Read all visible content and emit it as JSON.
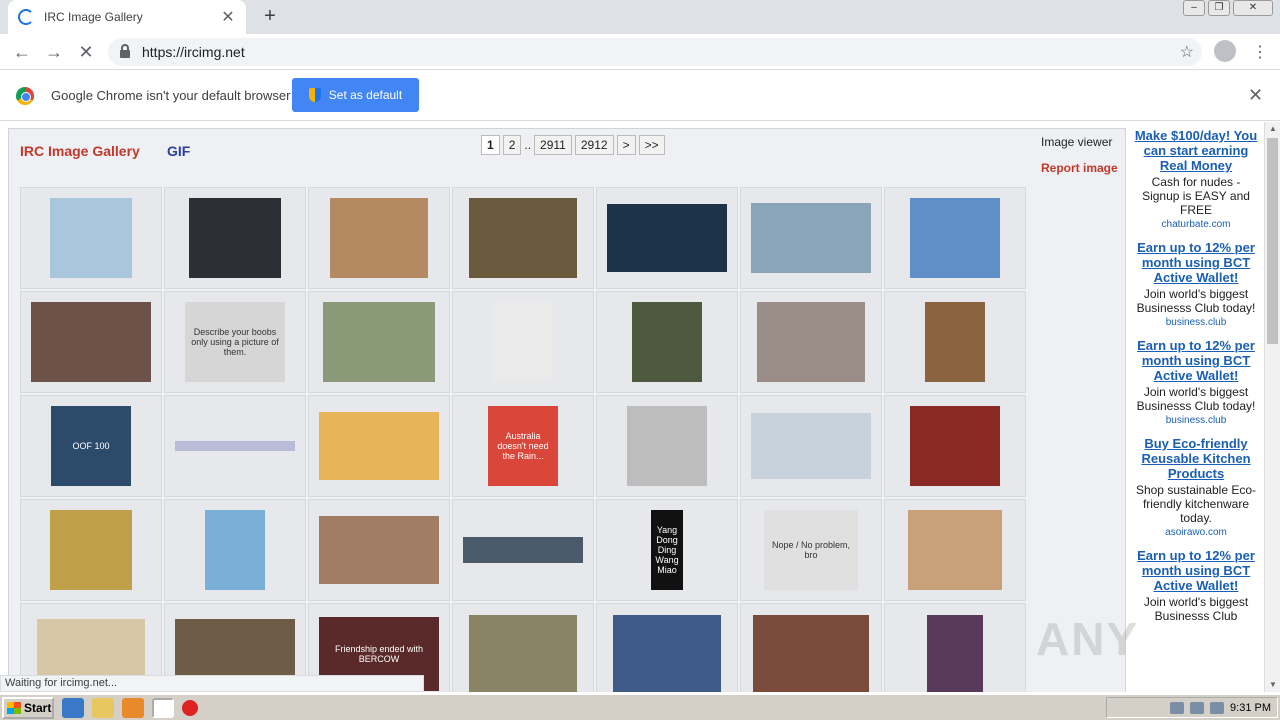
{
  "browser": {
    "tab_title": "IRC Image Gallery",
    "new_tab": "+",
    "tab_close": "✕",
    "url": "https://ircimg.net",
    "infobar_text": "Google Chrome isn't your default browser",
    "set_default_label": "Set as default",
    "infobar_close": "✕",
    "status_text": "Waiting for ircimg.net..."
  },
  "page": {
    "brand": "IRC Image Gallery",
    "gif_link": "GIF",
    "pagination": [
      "1",
      "2",
      "..",
      "2911",
      "2912",
      ">",
      ">>"
    ],
    "active_page": "1",
    "viewer_label": "Image viewer",
    "report_label": "Report image"
  },
  "thumbnails": [
    {
      "name": "cat-meme",
      "color": "#a9c6dc",
      "w": 82,
      "h": 80,
      "caption": ""
    },
    {
      "name": "dark-text-screenshot",
      "color": "#2c3036",
      "w": 92,
      "h": 80,
      "caption": ""
    },
    {
      "name": "cake-meme",
      "color": "#b48a62",
      "w": 98,
      "h": 80,
      "caption": ""
    },
    {
      "name": "breakfast-plate",
      "color": "#6b5a3e",
      "w": 108,
      "h": 80,
      "caption": ""
    },
    {
      "name": "vision-car",
      "color": "#1d3347",
      "w": 120,
      "h": 68,
      "caption": ""
    },
    {
      "name": "rv-camper",
      "color": "#8aa4b8",
      "w": 120,
      "h": 70,
      "caption": ""
    },
    {
      "name": "blastoise",
      "color": "#5f8fc6",
      "w": 90,
      "h": 80,
      "caption": ""
    },
    {
      "name": "woman-eating",
      "color": "#6d5249",
      "w": 120,
      "h": 80,
      "caption": ""
    },
    {
      "name": "describe-text",
      "color": "#d6d6d6",
      "w": 100,
      "h": 80,
      "caption": "Describe your boobs only using a picture of them."
    },
    {
      "name": "game-meme",
      "color": "#8a9a78",
      "w": 112,
      "h": 80,
      "caption": ""
    },
    {
      "name": "chart-list",
      "color": "#eaeaea",
      "w": 60,
      "h": 80,
      "caption": ""
    },
    {
      "name": "armored-figure",
      "color": "#4d5a40",
      "w": 70,
      "h": 80,
      "caption": ""
    },
    {
      "name": "hotel-bed",
      "color": "#9a8c86",
      "w": 108,
      "h": 80,
      "caption": ""
    },
    {
      "name": "kitchen-room",
      "color": "#8a6440",
      "w": 60,
      "h": 80,
      "caption": ""
    },
    {
      "name": "oof-100",
      "color": "#2c4a6a",
      "w": 80,
      "h": 80,
      "caption": "OOF 100"
    },
    {
      "name": "thin-banner",
      "color": "#b8bcd8",
      "w": 120,
      "h": 10,
      "caption": ""
    },
    {
      "name": "emoji-hand",
      "color": "#e8b45a",
      "w": 120,
      "h": 68,
      "caption": ""
    },
    {
      "name": "red-text-post",
      "color": "#d9463a",
      "w": 70,
      "h": 80,
      "caption": "Australia doesn't need the Rain..."
    },
    {
      "name": "cartoon-drawing",
      "color": "#bdbdbd",
      "w": 80,
      "h": 80,
      "caption": ""
    },
    {
      "name": "map-graph",
      "color": "#c8d2dc",
      "w": 120,
      "h": 66,
      "caption": ""
    },
    {
      "name": "deadpool",
      "color": "#8a2a24",
      "w": 90,
      "h": 80,
      "caption": ""
    },
    {
      "name": "comic-spray",
      "color": "#c0a04a",
      "w": 82,
      "h": 80,
      "caption": ""
    },
    {
      "name": "coast-map",
      "color": "#7ab0d8",
      "w": 60,
      "h": 80,
      "caption": ""
    },
    {
      "name": "desert-sunset",
      "color": "#a07e66",
      "w": 120,
      "h": 68,
      "caption": ""
    },
    {
      "name": "horizon-strip",
      "color": "#4a5a6a",
      "w": 120,
      "h": 26,
      "caption": ""
    },
    {
      "name": "name-list",
      "color": "#111111",
      "w": 32,
      "h": 80,
      "caption": "Yang Dong Ding Wang Miao"
    },
    {
      "name": "trollface",
      "color": "#e0e0e0",
      "w": 94,
      "h": 80,
      "caption": "Nope / No problem, bro"
    },
    {
      "name": "two-panel-meme",
      "color": "#c8a07a",
      "w": 94,
      "h": 80,
      "caption": ""
    },
    {
      "name": "pillow-object",
      "color": "#d7c7a7",
      "w": 108,
      "h": 70,
      "caption": ""
    },
    {
      "name": "game-screenshot",
      "color": "#6e5c48",
      "w": 120,
      "h": 70,
      "caption": ""
    },
    {
      "name": "bercow-meme",
      "color": "#5a2a2a",
      "w": 120,
      "h": 74,
      "caption": "Friendship ended with BERCOW"
    },
    {
      "name": "cavalry-painting",
      "color": "#8a8466",
      "w": 108,
      "h": 78,
      "caption": ""
    },
    {
      "name": "sleeping-man",
      "color": "#3d5a88",
      "w": 108,
      "h": 78,
      "caption": ""
    },
    {
      "name": "creature-art",
      "color": "#7a4a3a",
      "w": 116,
      "h": 78,
      "caption": ""
    },
    {
      "name": "anime-girl",
      "color": "#5a3a5a",
      "w": 56,
      "h": 78,
      "caption": ""
    }
  ],
  "ads": [
    {
      "title": "Make $100/day! You can start earning Real Money",
      "body": "Cash for nudes - Signup is EASY and FREE",
      "domain": "chaturbate.com"
    },
    {
      "title": "Earn up to 12% per month using BCT Active Wallet!",
      "body": "Join world's biggest Businesss Club today!",
      "domain": "business.club"
    },
    {
      "title": "Earn up to 12% per month using BCT Active Wallet!",
      "body": "Join world's biggest Businesss Club today!",
      "domain": "business.club"
    },
    {
      "title": "Buy Eco-friendly Reusable Kitchen Products",
      "body": "Shop sustainable Eco-friendly kitchenware today.",
      "domain": "asoirawo.com"
    },
    {
      "title": "Earn up to 12% per month using BCT Active Wallet!",
      "body": "Join world's biggest Businesss Club",
      "domain": ""
    }
  ],
  "watermark": "ANY",
  "taskbar": {
    "start_label": "Start",
    "clock": "9:31 PM"
  }
}
